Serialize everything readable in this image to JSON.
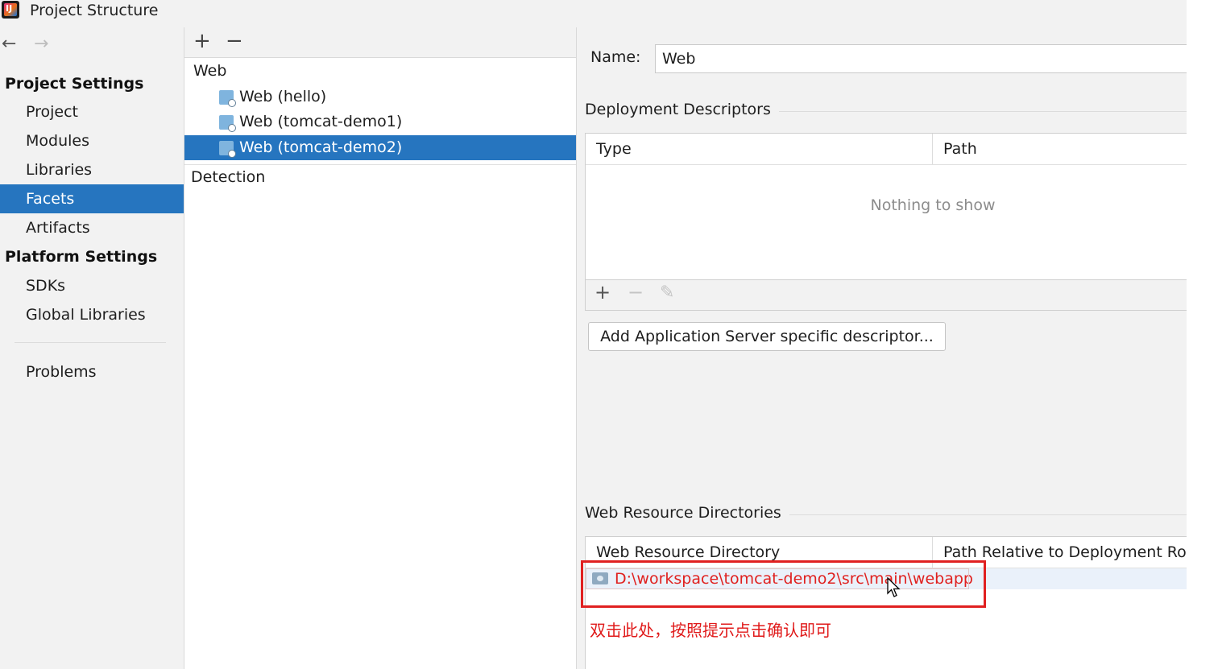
{
  "window": {
    "title": "Project Structure"
  },
  "colors": {
    "selection": "#2675bf",
    "highlight": "#e02020",
    "hint_text": "#e01a1a"
  },
  "sidebar": {
    "back_icon": "←",
    "forward_icon": "→",
    "project_settings_header": "Project Settings",
    "project_items": [
      "Project",
      "Modules",
      "Libraries",
      "Facets",
      "Artifacts"
    ],
    "platform_settings_header": "Platform Settings",
    "platform_items": [
      "SDKs",
      "Global Libraries"
    ],
    "problems": "Problems",
    "selected": "Facets"
  },
  "facets_panel": {
    "add_icon": "+",
    "remove_icon": "−",
    "group_label": "Web",
    "items": [
      "Web (hello)",
      "Web (tomcat-demo1)",
      "Web (tomcat-demo2)"
    ],
    "selected": "Web (tomcat-demo2)",
    "detection_label": "Detection"
  },
  "detail": {
    "name_label": "Name:",
    "name_value": "Web",
    "deployment_descriptors": {
      "title": "Deployment Descriptors",
      "columns": [
        "Type",
        "Path"
      ],
      "empty_text": "Nothing to show",
      "toolbar": {
        "add": "+",
        "remove": "−",
        "edit": "✎"
      }
    },
    "add_descriptor_button": "Add Application Server specific descriptor...",
    "web_resource_directories": {
      "title": "Web Resource Directories",
      "columns": [
        "Web Resource Directory",
        "Path Relative to Deployment Roo"
      ],
      "rows": [
        {
          "directory": "D:\\workspace\\tomcat-demo2\\src\\main\\webapp"
        }
      ]
    }
  },
  "annotation": {
    "hint": "双击此处，按照提示点击确认即可"
  }
}
